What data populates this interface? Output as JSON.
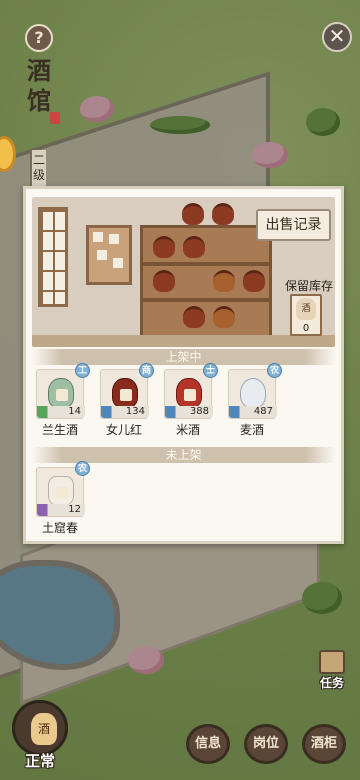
{
  "hud": {
    "help_icon": "?",
    "close_icon": "✕",
    "title_chars": [
      "酒",
      "馆"
    ],
    "level_chars": [
      "二",
      "级"
    ]
  },
  "panel": {
    "sales_record_label": "出售记录",
    "reserve_label": "保留库存",
    "reserve_item_icon_text": "酒",
    "reserve_count": "0",
    "on_shelf_header": "上架中",
    "off_shelf_header": "未上架",
    "on_shelf_items": [
      {
        "name": "兰生酒",
        "count": "14",
        "badge": "工",
        "bar_color": "#5aa35a"
      },
      {
        "name": "女儿红",
        "count": "134",
        "badge": "商",
        "bar_color": "#4f86bf"
      },
      {
        "name": "米酒",
        "count": "388",
        "badge": "士",
        "bar_color": "#4f86bf"
      },
      {
        "name": "麦酒",
        "count": "487",
        "badge": "农",
        "bar_color": "#4f86bf"
      }
    ],
    "off_shelf_items": [
      {
        "name": "土窟春",
        "count": "12",
        "badge": "农",
        "bar_color": "#8d62b3"
      }
    ]
  },
  "bottom_bar": {
    "status_icon_text": "酒",
    "status_label": "正常",
    "task_label": "任务",
    "info_label": "信息",
    "position_label": "岗位",
    "cabinet_label": "酒柜"
  }
}
